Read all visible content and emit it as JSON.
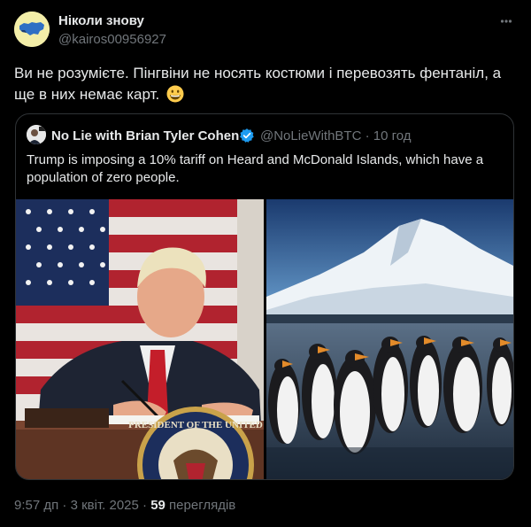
{
  "author": {
    "name": "Ніколи знову",
    "handle": "@kairos00956927"
  },
  "tweet": {
    "text": "Ви не розумієте. Пінгвіни не носять костюми і перевозять фентаніл, а ще в них немає карт.",
    "emoji": "grinning-face"
  },
  "quoted": {
    "name": "No Lie with Brian Tyler Cohen",
    "handle_time": "@NoLieWithBTC · 10 год",
    "text": "Trump is imposing a 10% tariff on Heard and McDonald Islands, which have a population of zero people.",
    "seal_text": "PRESIDENT OF THE UNITED"
  },
  "meta": {
    "timestamp": "9:57 дп · 3 квіт. 2025 · ",
    "views_count": "59",
    "views_label": " переглядів"
  },
  "colors": {
    "background": "#000000",
    "text": "#e7e9ea",
    "secondary": "#71767b",
    "border": "#2f3336",
    "verified": "#1d9bf0"
  }
}
